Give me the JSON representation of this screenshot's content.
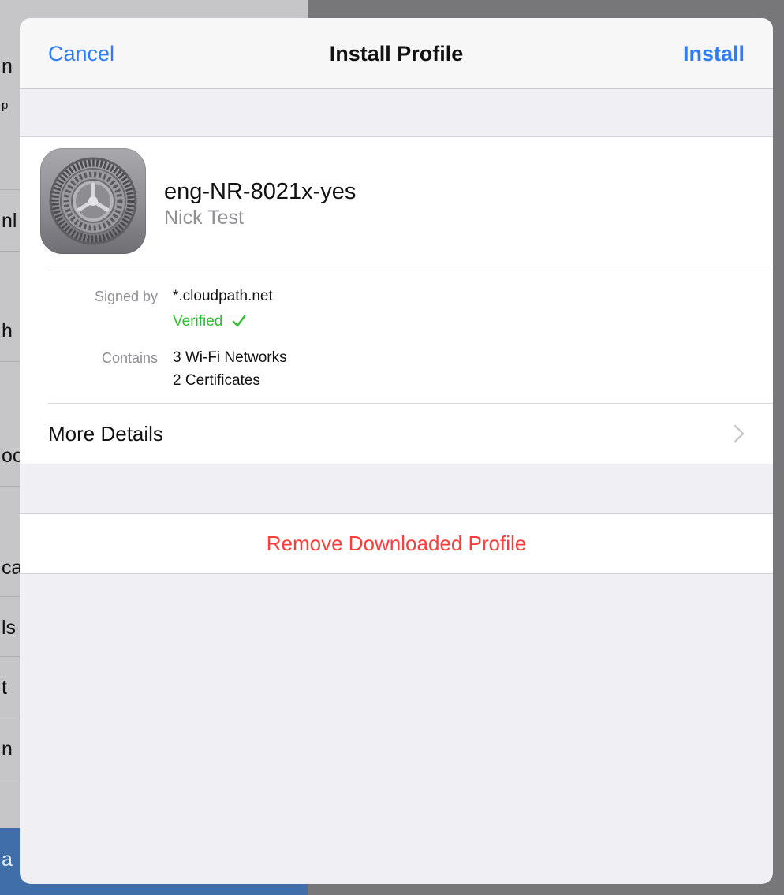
{
  "background": {
    "peek_glyphs": [
      "n",
      "p",
      "nl",
      "h",
      "oc",
      "ca",
      "ls",
      "t",
      "n",
      "a"
    ]
  },
  "navbar": {
    "cancel_label": "Cancel",
    "title": "Install Profile",
    "install_label": "Install"
  },
  "profile": {
    "icon": "settings-gear-icon",
    "name": "eng-NR-8021x-yes",
    "organization": "Nick Test",
    "signed_by_label": "Signed by",
    "signed_by_value": "*.cloudpath.net",
    "verified_label": "Verified",
    "contains_label": "Contains",
    "contains_values": [
      "3 Wi-Fi Networks",
      "2 Certificates"
    ]
  },
  "more_details": {
    "label": "More Details",
    "icon": "chevron-right-icon"
  },
  "remove": {
    "label": "Remove Downloaded Profile"
  },
  "colors": {
    "accent_blue": "#2f7df6",
    "verified_green": "#2dc12f",
    "destructive_red": "#fc3d39",
    "grouped_background": "#efeff4"
  }
}
